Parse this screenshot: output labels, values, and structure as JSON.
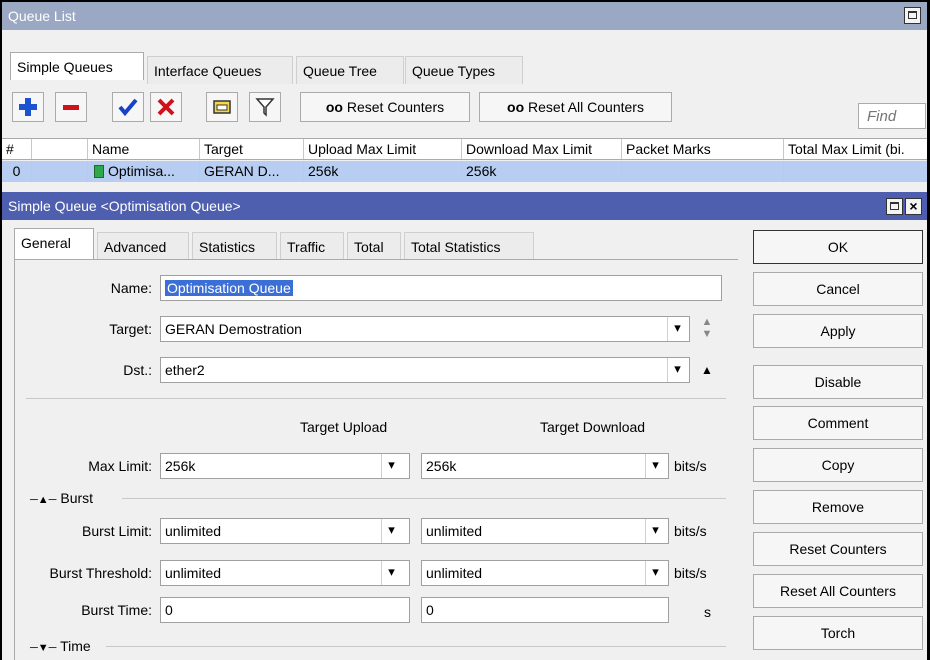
{
  "queue_list": {
    "title": "Queue List",
    "tabs": [
      "Simple Queues",
      "Interface Queues",
      "Queue Tree",
      "Queue Types"
    ],
    "toolbar": {
      "reset_counters": "Reset Counters",
      "reset_all_counters": "Reset All Counters",
      "oo_glyph": "oo",
      "find_placeholder": "Find"
    },
    "columns": [
      "#",
      "",
      "Name",
      "Target",
      "Upload Max Limit",
      "Download Max Limit",
      "Packet Marks",
      "Total Max Limit (bi."
    ],
    "row": {
      "index": "0",
      "name": "Optimisa...",
      "target": "GERAN D...",
      "upload": "256k",
      "download": "256k"
    }
  },
  "dialog": {
    "title": "Simple Queue <Optimisation Queue>",
    "tabs": [
      "General",
      "Advanced",
      "Statistics",
      "Traffic",
      "Total",
      "Total Statistics"
    ],
    "labels": {
      "name": "Name:",
      "target": "Target:",
      "dst": "Dst.:",
      "target_upload": "Target Upload",
      "target_download": "Target Download",
      "max_limit": "Max Limit:",
      "burst": "Burst",
      "burst_limit": "Burst Limit:",
      "burst_threshold": "Burst Threshold:",
      "burst_time": "Burst Time:",
      "time": "Time",
      "bits": "bits/s",
      "s": "s"
    },
    "values": {
      "name": "Optimisation Queue",
      "target": "GERAN Demostration",
      "dst": "ether2",
      "max_up": "256k",
      "max_down": "256k",
      "burst_limit_up": "unlimited",
      "burst_limit_down": "unlimited",
      "burst_threshold_up": "unlimited",
      "burst_threshold_down": "unlimited",
      "burst_time_up": "0",
      "burst_time_down": "0"
    },
    "buttons": [
      "OK",
      "Cancel",
      "Apply",
      "Disable",
      "Comment",
      "Copy",
      "Remove",
      "Reset Counters",
      "Reset All Counters",
      "Torch"
    ]
  },
  "colors": {
    "titlebar": "#9aa8c4",
    "dialog_title": "#4e5fb0",
    "selected_row": "#b7cdf2",
    "add": "#1a52d0",
    "remove": "#d0101a",
    "check": "#1a40c8",
    "x": "#d0101a"
  }
}
